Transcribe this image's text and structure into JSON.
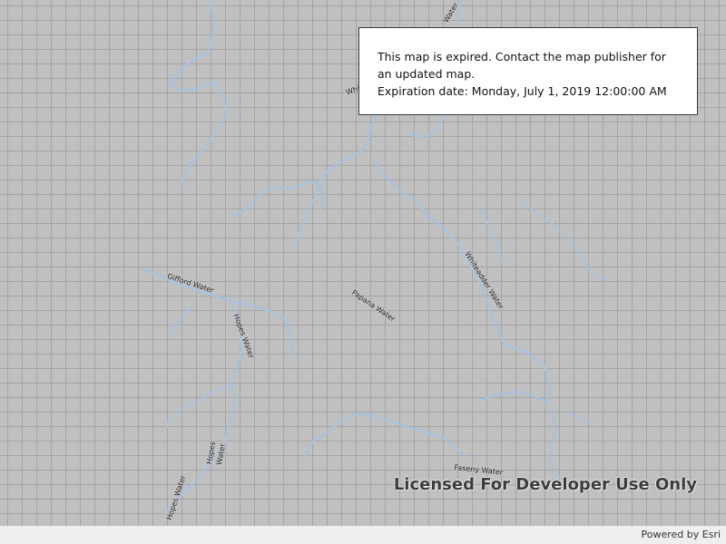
{
  "dialog": {
    "message": "This map is expired. Contact the map publisher for an updated map.",
    "expiration": "Expiration date: Monday, July 1, 2019 12:00:00 AM"
  },
  "watermark": "Licensed For Developer Use Only",
  "attribution": "Powered by Esri",
  "water_color": "#a9c1db",
  "labels": {
    "whiteadder_top": "Water",
    "partial_top_left": "Whi",
    "gifford": "Gifford Water",
    "hopes_1": "Hopes Water",
    "papana": "Papana Water",
    "whiteadder": "Whiteadder Water",
    "hopes_2_line1": "Hopes",
    "hopes_2_line2": "Water",
    "hopes_3": "Hopes Water",
    "fasney": "Faseny Water"
  }
}
